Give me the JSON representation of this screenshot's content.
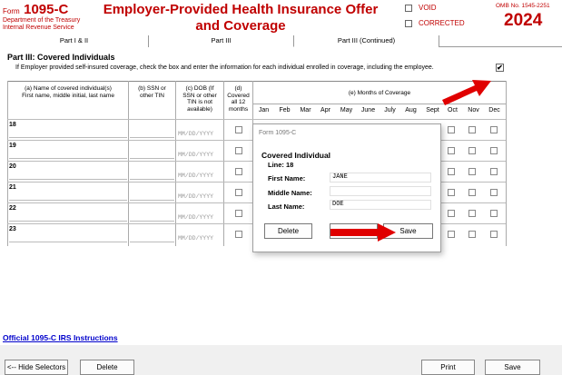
{
  "header": {
    "form_prefix": "Form",
    "form_number": "1095-C",
    "dept_line1": "Department of the Treasury",
    "dept_line2": "Internal Revenue Service",
    "title_line1": "Employer-Provided Health Insurance Offer",
    "title_line2": "and Coverage",
    "void_label": "VOID",
    "corrected_label": "CORRECTED",
    "omb": "OMB No. 1545-2251",
    "year": "2024"
  },
  "tabs": [
    {
      "label": "Part I & II"
    },
    {
      "label": "Part III"
    },
    {
      "label": "Part III (Continued)"
    }
  ],
  "part_title": "Part III:  Covered Individuals",
  "instruction": "If Employer provided self-insured coverage, check the box and enter the information for each individual enrolled in coverage, including the employee.",
  "instruction_checked_mark": "✔",
  "table": {
    "col_a": "(a) Name of covered individual(s)",
    "col_a2": "First name, middle initial, last name",
    "col_b": "(b) SSN or",
    "col_b2": "other TIN",
    "col_c1": "(c) DOB (If",
    "col_c2": "SSN or other",
    "col_c3": "TIN is not",
    "col_c4": "available)",
    "col_d1": "(d)",
    "col_d2": "Covered",
    "col_d3": "all 12",
    "col_d4": "months",
    "col_e": "(e) Months of Coverage",
    "months": [
      "Jan",
      "Feb",
      "Mar",
      "Apr",
      "May",
      "June",
      "July",
      "Aug",
      "Sept",
      "Oct",
      "Nov",
      "Dec"
    ],
    "rows": [
      "18",
      "19",
      "20",
      "21",
      "22",
      "23"
    ],
    "dob_placeholder": "MM/DD/YYYY"
  },
  "link_text": "Official 1095-C IRS Instructions",
  "bottom_buttons": {
    "hide_selectors": "<-- Hide Selectors",
    "delete": "Delete",
    "print": "Print",
    "save": "Save"
  },
  "modal": {
    "caption": "Form 1095-C",
    "heading": "Covered Individual",
    "line_label": "Line:  18",
    "first_name_label": "First Name:",
    "first_name_value": "JANE",
    "middle_name_label": "Middle Name:",
    "middle_name_value": "",
    "last_name_label": "Last Name:",
    "last_name_value": "DOE",
    "delete_label": "Delete",
    "cancel_label": "",
    "save_label": "Save"
  },
  "colors": {
    "form_red": "#c00000",
    "link_blue": "#0000cc",
    "arrow_red": "#e00000"
  }
}
